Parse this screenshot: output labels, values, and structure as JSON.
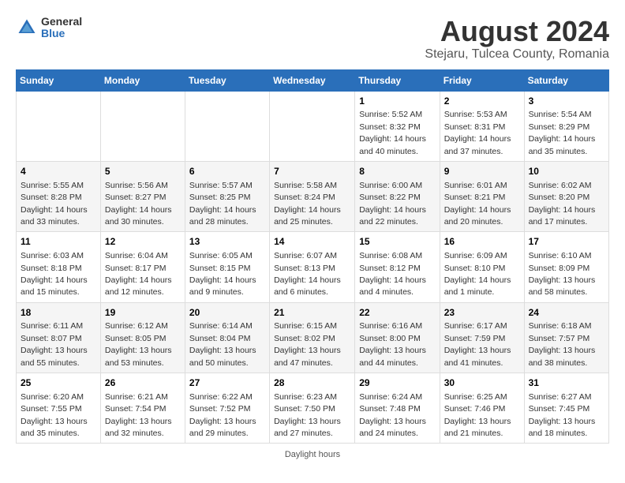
{
  "header": {
    "logo_general": "General",
    "logo_blue": "Blue",
    "month_year": "August 2024",
    "location": "Stejaru, Tulcea County, Romania"
  },
  "weekdays": [
    "Sunday",
    "Monday",
    "Tuesday",
    "Wednesday",
    "Thursday",
    "Friday",
    "Saturday"
  ],
  "footer": {
    "note": "Daylight hours"
  },
  "weeks": [
    [
      {
        "day": "",
        "sunrise": "",
        "sunset": "",
        "daylight": ""
      },
      {
        "day": "",
        "sunrise": "",
        "sunset": "",
        "daylight": ""
      },
      {
        "day": "",
        "sunrise": "",
        "sunset": "",
        "daylight": ""
      },
      {
        "day": "",
        "sunrise": "",
        "sunset": "",
        "daylight": ""
      },
      {
        "day": "1",
        "sunrise": "5:52 AM",
        "sunset": "8:32 PM",
        "daylight": "14 hours and 40 minutes."
      },
      {
        "day": "2",
        "sunrise": "5:53 AM",
        "sunset": "8:31 PM",
        "daylight": "14 hours and 37 minutes."
      },
      {
        "day": "3",
        "sunrise": "5:54 AM",
        "sunset": "8:29 PM",
        "daylight": "14 hours and 35 minutes."
      }
    ],
    [
      {
        "day": "4",
        "sunrise": "5:55 AM",
        "sunset": "8:28 PM",
        "daylight": "14 hours and 33 minutes."
      },
      {
        "day": "5",
        "sunrise": "5:56 AM",
        "sunset": "8:27 PM",
        "daylight": "14 hours and 30 minutes."
      },
      {
        "day": "6",
        "sunrise": "5:57 AM",
        "sunset": "8:25 PM",
        "daylight": "14 hours and 28 minutes."
      },
      {
        "day": "7",
        "sunrise": "5:58 AM",
        "sunset": "8:24 PM",
        "daylight": "14 hours and 25 minutes."
      },
      {
        "day": "8",
        "sunrise": "6:00 AM",
        "sunset": "8:22 PM",
        "daylight": "14 hours and 22 minutes."
      },
      {
        "day": "9",
        "sunrise": "6:01 AM",
        "sunset": "8:21 PM",
        "daylight": "14 hours and 20 minutes."
      },
      {
        "day": "10",
        "sunrise": "6:02 AM",
        "sunset": "8:20 PM",
        "daylight": "14 hours and 17 minutes."
      }
    ],
    [
      {
        "day": "11",
        "sunrise": "6:03 AM",
        "sunset": "8:18 PM",
        "daylight": "14 hours and 15 minutes."
      },
      {
        "day": "12",
        "sunrise": "6:04 AM",
        "sunset": "8:17 PM",
        "daylight": "14 hours and 12 minutes."
      },
      {
        "day": "13",
        "sunrise": "6:05 AM",
        "sunset": "8:15 PM",
        "daylight": "14 hours and 9 minutes."
      },
      {
        "day": "14",
        "sunrise": "6:07 AM",
        "sunset": "8:13 PM",
        "daylight": "14 hours and 6 minutes."
      },
      {
        "day": "15",
        "sunrise": "6:08 AM",
        "sunset": "8:12 PM",
        "daylight": "14 hours and 4 minutes."
      },
      {
        "day": "16",
        "sunrise": "6:09 AM",
        "sunset": "8:10 PM",
        "daylight": "14 hours and 1 minute."
      },
      {
        "day": "17",
        "sunrise": "6:10 AM",
        "sunset": "8:09 PM",
        "daylight": "13 hours and 58 minutes."
      }
    ],
    [
      {
        "day": "18",
        "sunrise": "6:11 AM",
        "sunset": "8:07 PM",
        "daylight": "13 hours and 55 minutes."
      },
      {
        "day": "19",
        "sunrise": "6:12 AM",
        "sunset": "8:05 PM",
        "daylight": "13 hours and 53 minutes."
      },
      {
        "day": "20",
        "sunrise": "6:14 AM",
        "sunset": "8:04 PM",
        "daylight": "13 hours and 50 minutes."
      },
      {
        "day": "21",
        "sunrise": "6:15 AM",
        "sunset": "8:02 PM",
        "daylight": "13 hours and 47 minutes."
      },
      {
        "day": "22",
        "sunrise": "6:16 AM",
        "sunset": "8:00 PM",
        "daylight": "13 hours and 44 minutes."
      },
      {
        "day": "23",
        "sunrise": "6:17 AM",
        "sunset": "7:59 PM",
        "daylight": "13 hours and 41 minutes."
      },
      {
        "day": "24",
        "sunrise": "6:18 AM",
        "sunset": "7:57 PM",
        "daylight": "13 hours and 38 minutes."
      }
    ],
    [
      {
        "day": "25",
        "sunrise": "6:20 AM",
        "sunset": "7:55 PM",
        "daylight": "13 hours and 35 minutes."
      },
      {
        "day": "26",
        "sunrise": "6:21 AM",
        "sunset": "7:54 PM",
        "daylight": "13 hours and 32 minutes."
      },
      {
        "day": "27",
        "sunrise": "6:22 AM",
        "sunset": "7:52 PM",
        "daylight": "13 hours and 29 minutes."
      },
      {
        "day": "28",
        "sunrise": "6:23 AM",
        "sunset": "7:50 PM",
        "daylight": "13 hours and 27 minutes."
      },
      {
        "day": "29",
        "sunrise": "6:24 AM",
        "sunset": "7:48 PM",
        "daylight": "13 hours and 24 minutes."
      },
      {
        "day": "30",
        "sunrise": "6:25 AM",
        "sunset": "7:46 PM",
        "daylight": "13 hours and 21 minutes."
      },
      {
        "day": "31",
        "sunrise": "6:27 AM",
        "sunset": "7:45 PM",
        "daylight": "13 hours and 18 minutes."
      }
    ]
  ]
}
